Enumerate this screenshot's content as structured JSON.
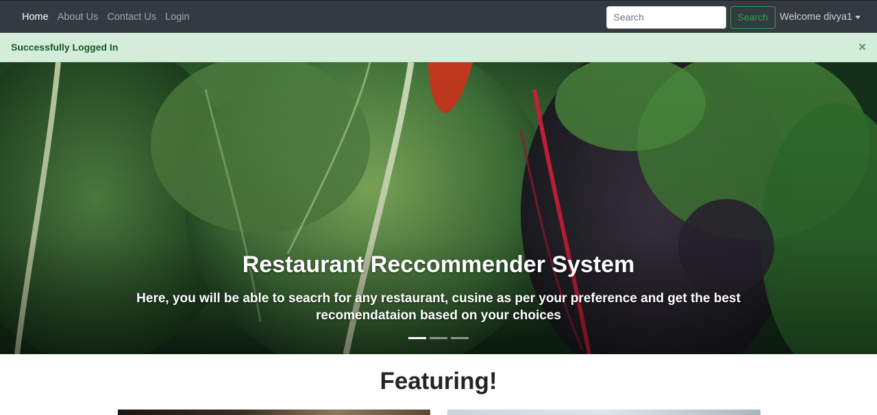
{
  "navbar": {
    "links": [
      {
        "label": "Home",
        "active": true
      },
      {
        "label": "About Us",
        "active": false
      },
      {
        "label": "Contact Us",
        "active": false
      },
      {
        "label": "Login",
        "active": false
      }
    ],
    "search_placeholder": "Search",
    "search_button": "Search",
    "user_menu": "Welcome divya1",
    "background_color": "#343a40"
  },
  "alert": {
    "message": "Successfully Logged In",
    "close_symbol": "×",
    "color": "#d4edda"
  },
  "carousel": {
    "title": "Restaurant Reccommender System",
    "text": "Here, you will be able to seacrh for any restaurant, cusine as per your preference and get the best recomendataion based on your choices",
    "slide_count": 3,
    "active_slide": 1
  },
  "featuring": {
    "heading": "Featuring!"
  },
  "colors": {
    "accent_success": "#28a745",
    "alert_text": "#155724"
  }
}
